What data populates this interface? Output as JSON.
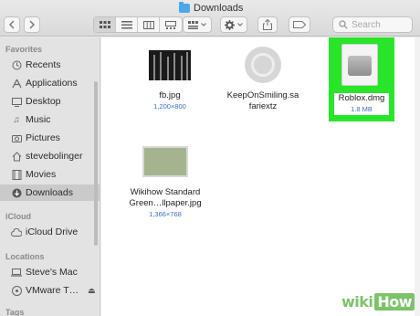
{
  "window": {
    "title": "Downloads"
  },
  "toolbar": {
    "back_icon": "chevron-left-icon",
    "forward_icon": "chevron-right-icon",
    "view_modes": [
      "icon-view",
      "list-view",
      "column-view",
      "gallery-view"
    ],
    "active_view": "icon-view",
    "search_placeholder": "Search"
  },
  "sidebar": {
    "favorites_header": "Favorites",
    "favorites": [
      {
        "label": "Recents",
        "icon": "clock-icon"
      },
      {
        "label": "Applications",
        "icon": "applications-icon"
      },
      {
        "label": "Desktop",
        "icon": "desktop-icon"
      },
      {
        "label": "Music",
        "icon": "music-icon"
      },
      {
        "label": "Pictures",
        "icon": "camera-icon"
      },
      {
        "label": "stevebolinger",
        "icon": "home-icon"
      },
      {
        "label": "Movies",
        "icon": "film-icon"
      },
      {
        "label": "Downloads",
        "icon": "download-icon",
        "selected": true
      }
    ],
    "icloud_header": "iCloud",
    "icloud": [
      {
        "label": "iCloud Drive",
        "icon": "cloud-icon"
      }
    ],
    "locations_header": "Locations",
    "locations": [
      {
        "label": "Steve's Mac",
        "icon": "laptop-icon"
      },
      {
        "label": "VMware T…",
        "icon": "disk-icon"
      }
    ],
    "tags_header": "Tags"
  },
  "files": [
    {
      "name_line1": "fb.jpg",
      "name_line2": "",
      "meta": "1,200×800"
    },
    {
      "name_line1": "KeepOnSmiling.sa",
      "name_line2": "fariextz",
      "meta": ""
    },
    {
      "name_line1": "Roblox.dmg",
      "name_line2": "",
      "meta": "1.8 MB",
      "selected": true
    },
    {
      "name_line1": "Wikihow Standard",
      "name_line2": "Green…llpaper.jpg",
      "meta": "1,366×768"
    }
  ],
  "colors": {
    "highlight": "#29e52a",
    "accent": "#3a6fc4"
  },
  "watermark": {
    "wiki": "wiki",
    "how": "How"
  }
}
